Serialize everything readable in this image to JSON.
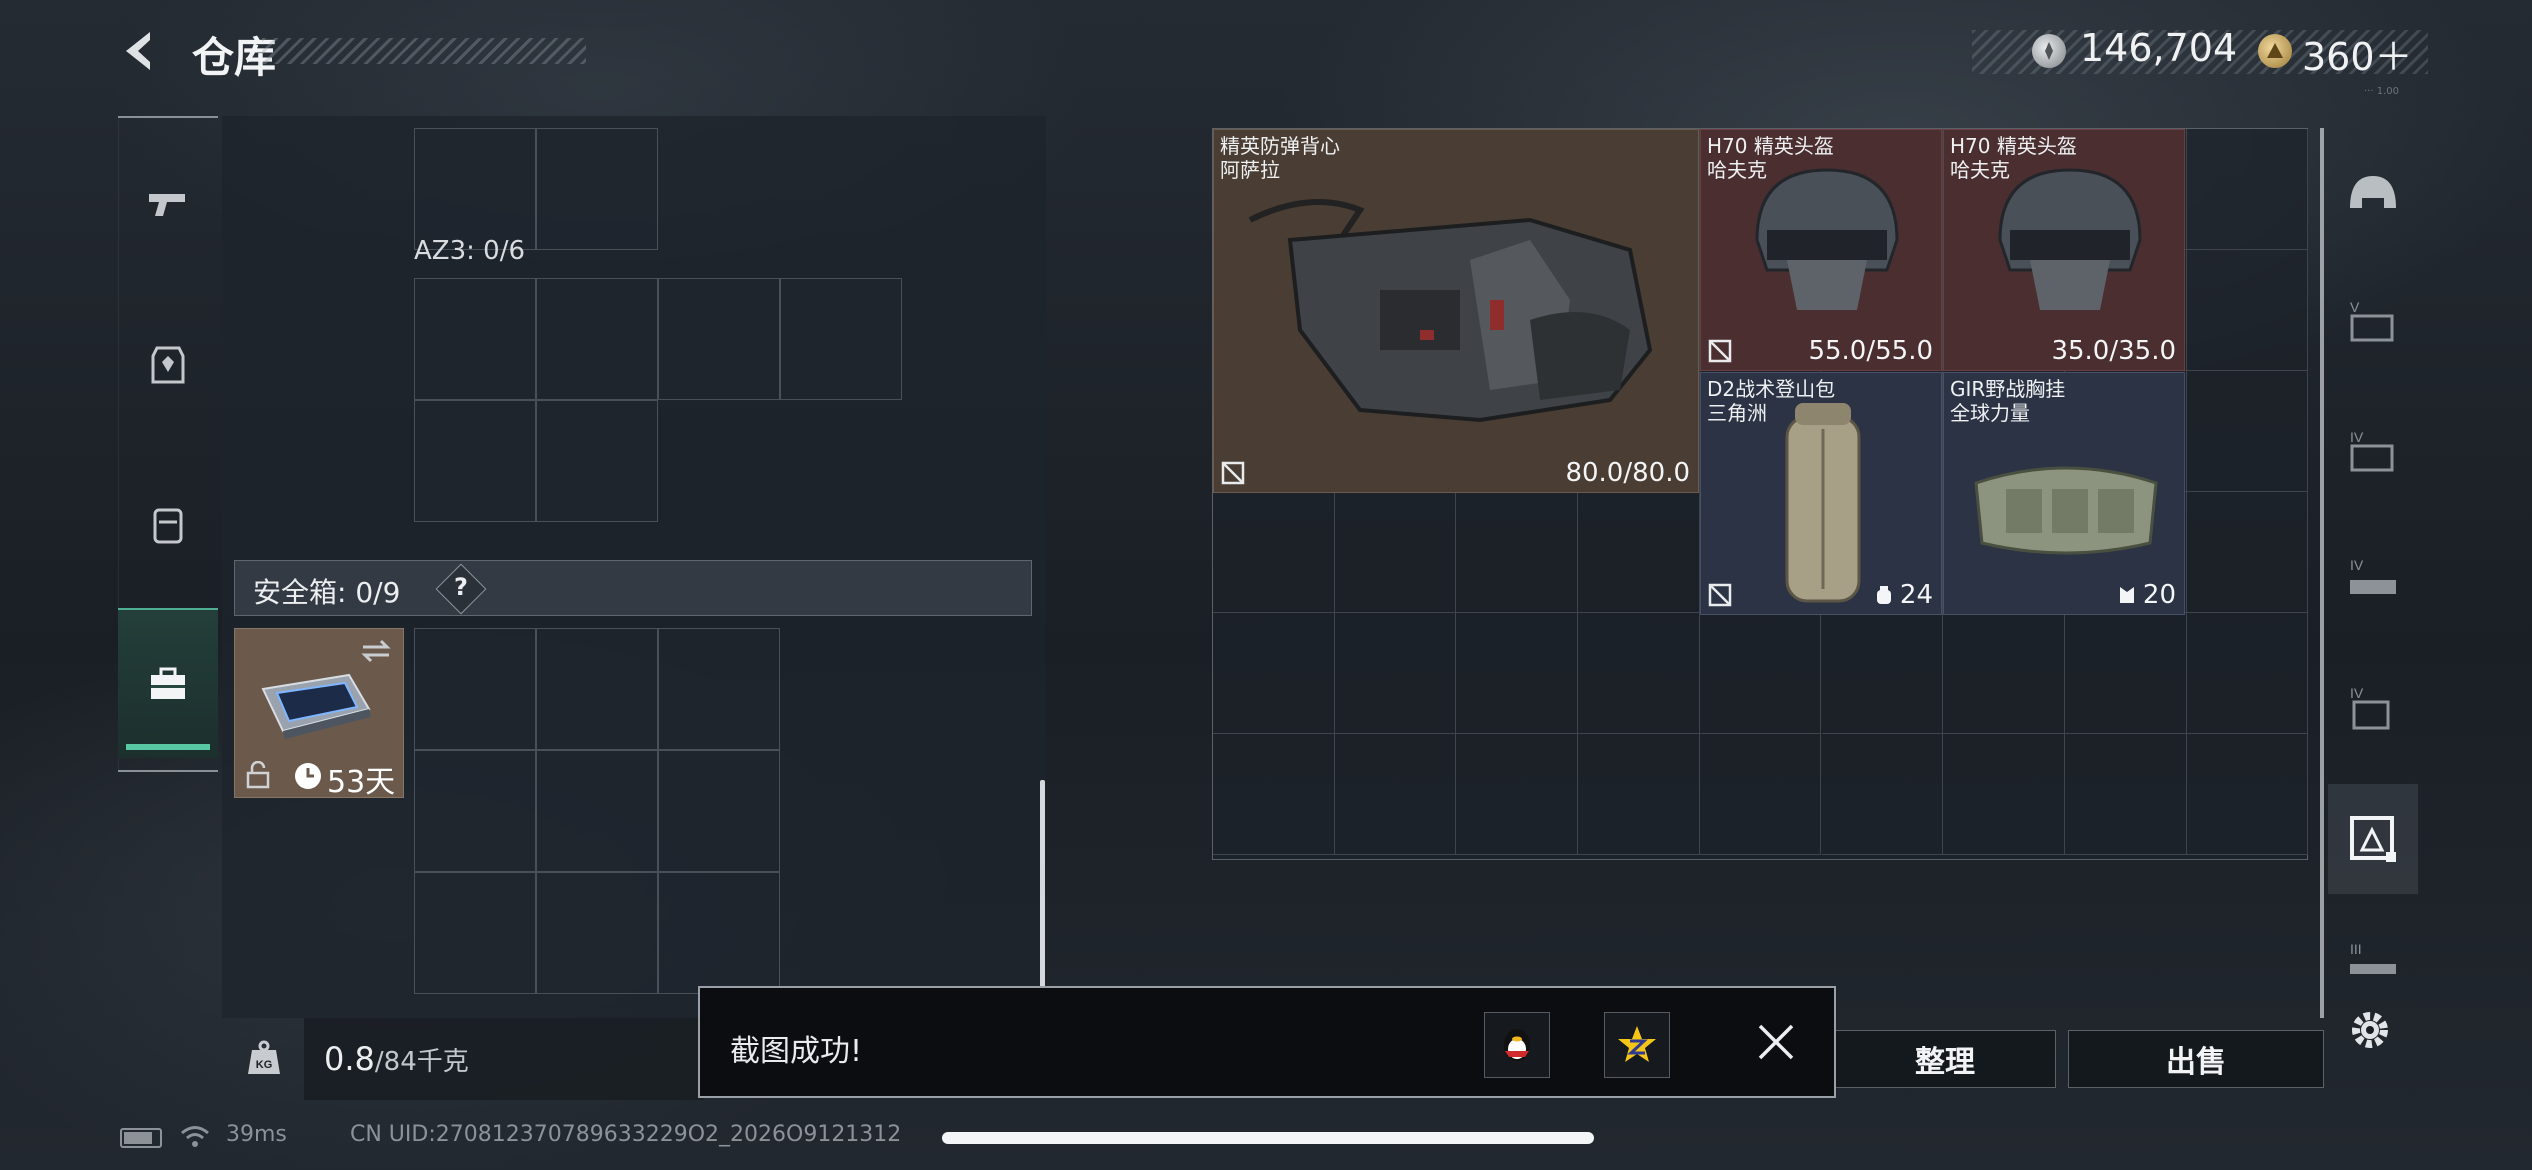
{
  "header": {
    "title": "仓库",
    "currency_silver": "146,704",
    "currency_gold": "360＋",
    "tiny_text": "··· 1.00"
  },
  "left_panel": {
    "pouch_label": "AZ3: 0/6",
    "safe_label": "安全箱: 0/9",
    "help": "?",
    "case_item": {
      "days": "53天"
    },
    "weight_value": "0.8",
    "weight_max": "/84千克"
  },
  "stash_items": [
    {
      "name_line1": "精英防弹背心",
      "name_line2": "阿萨拉",
      "durability": "80.0/80.0",
      "color": "brown"
    },
    {
      "name_line1": "H70 精英头盔",
      "name_line2": "哈夫克",
      "durability": "55.0/55.0",
      "color": "red"
    },
    {
      "name_line1": "H70 精英头盔",
      "name_line2": "哈夫克",
      "durability": "35.0/35.0",
      "color": "red"
    },
    {
      "name_line1": "D2战术登山包",
      "name_line2": "三角洲",
      "capacity": "24",
      "color": "blue"
    },
    {
      "name_line1": "GIR野战胸挂",
      "name_line2": "全球力量",
      "capacity": "20",
      "color": "blue"
    }
  ],
  "buttons": {
    "sort": "整理",
    "sell": "出售"
  },
  "toast": {
    "message": "截图成功!"
  },
  "status": {
    "ping": "39ms",
    "uid": "CN UID:270812370789633229O2_2026O9121312"
  },
  "icons": {
    "rail": [
      "pistol-icon",
      "armor-vest-icon",
      "backpack-icon",
      "toolbox-icon"
    ],
    "right_rail": [
      "helmet-filter-icon",
      "tier-v-icon",
      "tier-iv-icon",
      "tier-iv-rig-icon",
      "tier-iv-case-icon",
      "container-filter-icon",
      "tier-iii-icon"
    ]
  }
}
